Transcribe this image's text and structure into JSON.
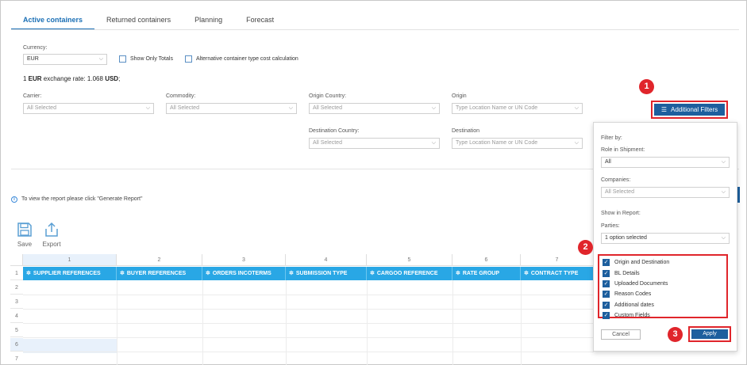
{
  "tabs": [
    "Active containers",
    "Returned containers",
    "Planning",
    "Forecast"
  ],
  "currency": {
    "label": "Currency:",
    "value": "EUR"
  },
  "show_only_totals": "Show Only Totals",
  "alt_cost_calc": "Alternative container type cost calculation",
  "rate": {
    "prefix": "1 ",
    "cur": "EUR",
    "mid": " exchange rate: 1.068 ",
    "cur2": "USD",
    "suffix": ";"
  },
  "filters": {
    "carrier": {
      "label": "Carrier:",
      "value": "All Selected"
    },
    "commodity": {
      "label": "Commodity:",
      "value": "All Selected"
    },
    "origin_country": {
      "label": "Origin Country:",
      "value": "All Selected"
    },
    "origin": {
      "label": "Origin",
      "value": "Type Location Name or UN Code"
    },
    "destination_country": {
      "label": "Destination Country:",
      "value": "All Selected"
    },
    "destination": {
      "label": "Destination",
      "value": "Type Location Name or UN Code"
    }
  },
  "additional_filters_label": "Additional Filters",
  "info_text": "To view the report please click \"Generate Report\"",
  "toolbar": {
    "save": "Save",
    "export": "Export"
  },
  "grid": {
    "col_numbers": [
      "1",
      "2",
      "3",
      "4",
      "5",
      "6",
      "7"
    ],
    "row_numbers": [
      "1",
      "2",
      "3",
      "4",
      "5",
      "6",
      "7"
    ],
    "headers": [
      "SUPPLIER REFERENCES",
      "BUYER REFERENCES",
      "ORDERS INCOTERMS",
      "SUBMISSION TYPE",
      "CARGOO REFERENCE",
      "RATE GROUP",
      "CONTRACT TYPE"
    ],
    "header_color": "#29a7e5"
  },
  "panel": {
    "filter_by": "Filter by:",
    "role_label": "Role in Shipment:",
    "role_value": "All",
    "companies_label": "Companies:",
    "companies_value": "All Selected",
    "show_in_report": "Show in Report:",
    "parties_label": "Parties:",
    "parties_value": "1 option selected",
    "checks": [
      "Origin and Destination",
      "BL Details",
      "Uploaded Documents",
      "Reason Codes",
      "Additional dates",
      "Custom Fields"
    ],
    "cancel": "Cancel",
    "apply": "Apply"
  },
  "callouts": [
    "1",
    "2",
    "3"
  ],
  "colors": {
    "accent": "#1d5f9e",
    "callout": "#e0252b",
    "grid_header": "#29a7e5"
  }
}
